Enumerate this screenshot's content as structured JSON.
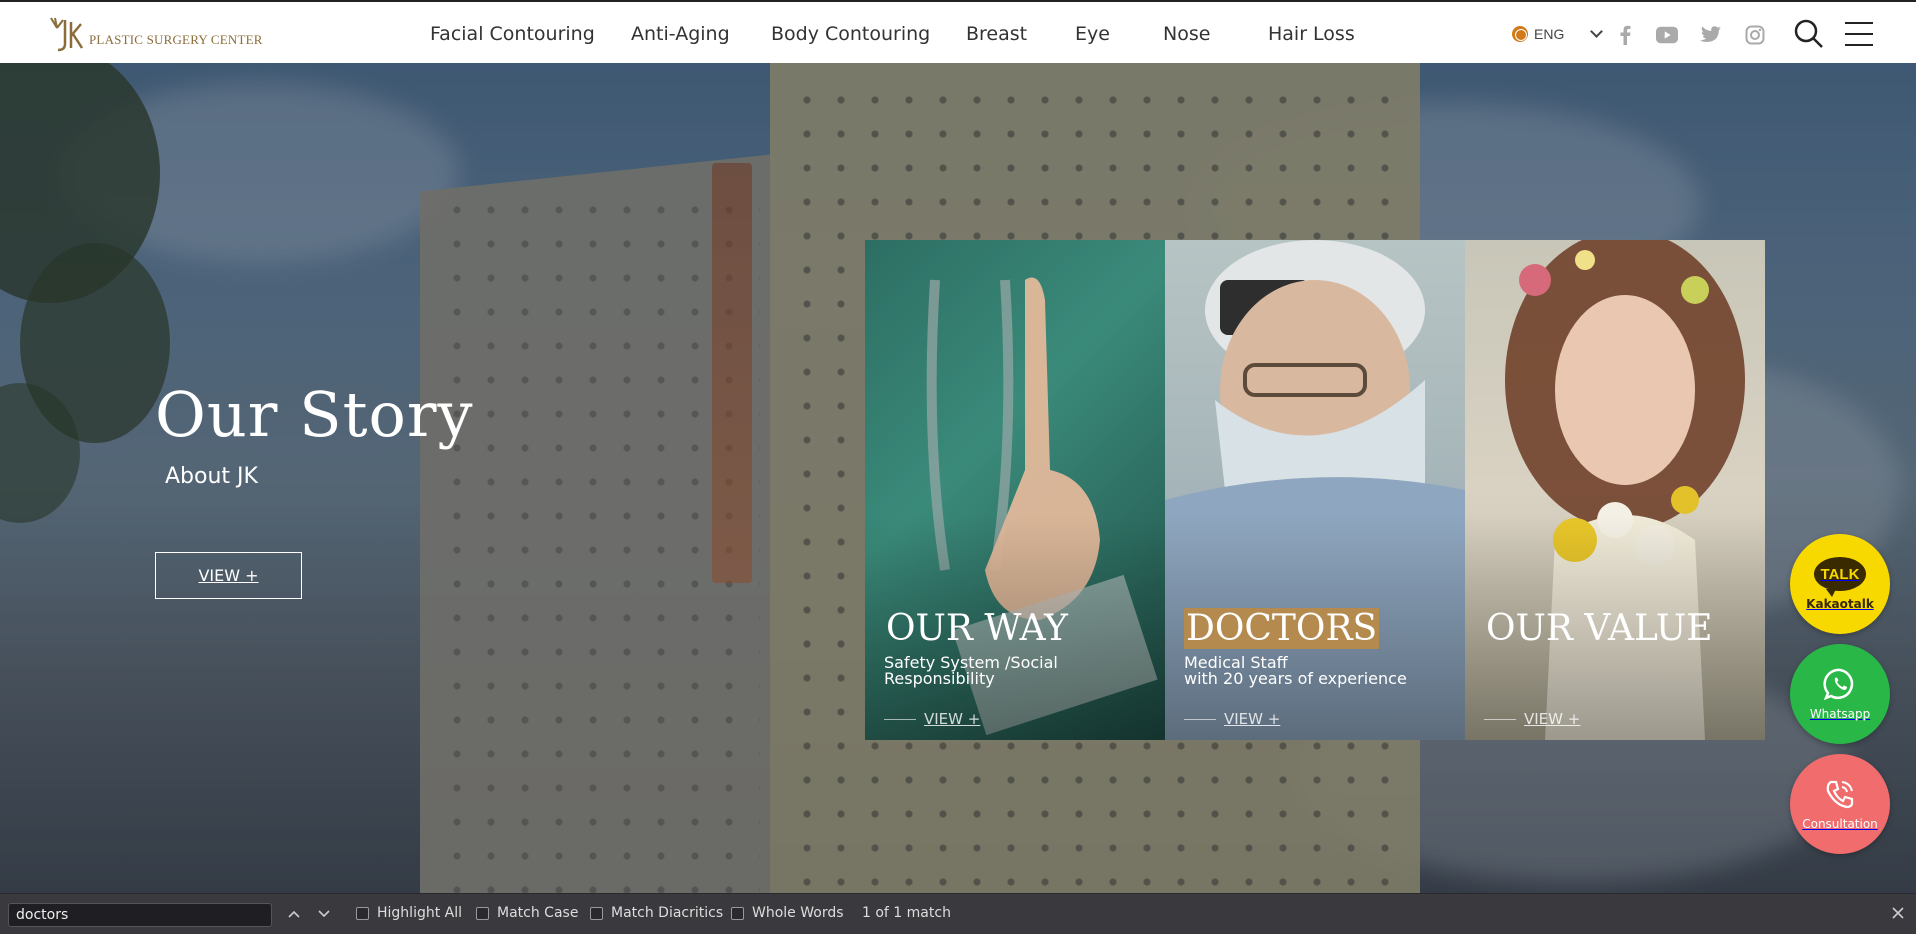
{
  "header": {
    "logo_text": "PLASTIC SURGERY CENTER",
    "nav": [
      {
        "label": "Facial Contouring"
      },
      {
        "label": "Anti-Aging"
      },
      {
        "label": "Body Contouring"
      },
      {
        "label": "Breast"
      },
      {
        "label": "Eye"
      },
      {
        "label": "Nose"
      },
      {
        "label": "Hair Loss"
      }
    ],
    "language": "ENG"
  },
  "hero": {
    "title": "Our Story",
    "subtitle": "About JK",
    "view_label": "VIEW +"
  },
  "cards": [
    {
      "title": "OUR WAY",
      "desc_line1": "Safety System /Social",
      "desc_line2": "Responsibility",
      "view_label": "VIEW +"
    },
    {
      "title": "DOCTORS",
      "desc_line1": "Medical Staff",
      "desc_line2": "with 20 years of experience",
      "view_label": "VIEW +"
    },
    {
      "title": "OUR VALUE",
      "desc_line1": "",
      "desc_line2": "",
      "view_label": "VIEW +"
    }
  ],
  "fabs": {
    "kakao_badge": "TALK",
    "kakao_label": "Kakaotalk",
    "whatsapp_label": "Whatsapp",
    "consult_label": "Consultation"
  },
  "findbar": {
    "query": "doctors",
    "highlight_all": "Highlight All",
    "match_case": "Match Case",
    "match_diacritics": "Match Diacritics",
    "whole_words": "Whole Words",
    "status": "1 of 1 match"
  },
  "colors": {
    "brand_gold": "#8a6d3b",
    "highlight": "#b48a4e",
    "kakao": "#f7d900",
    "whatsapp": "#29b847",
    "consult": "#f16d6d"
  }
}
